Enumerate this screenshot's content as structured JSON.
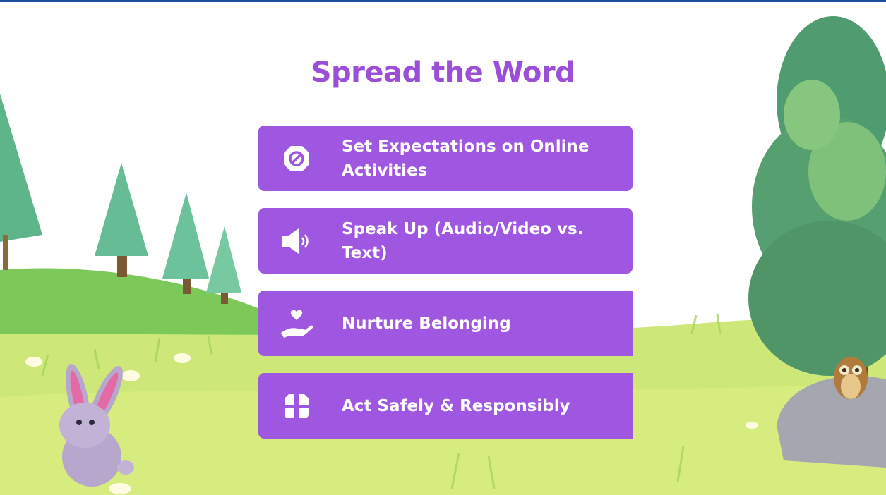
{
  "slide": {
    "title": "Spread the Word",
    "items": [
      {
        "label": "Set Expectations on Online Activities",
        "icon": "prohibited-icon"
      },
      {
        "label": "Speak Up (Audio/Video vs. Text)",
        "icon": "speaker-icon"
      },
      {
        "label": "Nurture Belonging",
        "icon": "hand-heart-icon"
      },
      {
        "label": "Act Safely & Responsibly",
        "icon": "life-vest-icon"
      }
    ]
  },
  "colors": {
    "title": "#9b4fd9",
    "card": "#9f57e2",
    "accent_bar": "#1f4e9a"
  }
}
